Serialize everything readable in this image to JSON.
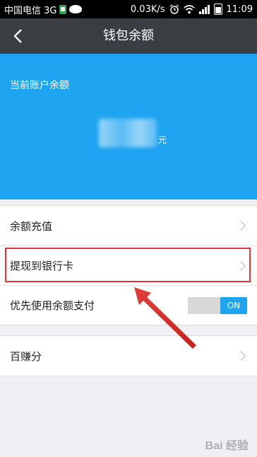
{
  "status_bar": {
    "carrier": "中国电信 3G",
    "speed": "0.03K/s",
    "time": "11:09"
  },
  "nav": {
    "title": "钱包余额"
  },
  "balance": {
    "label": "当前账户余额",
    "unit": "元"
  },
  "menu": {
    "recharge": "余额充值",
    "withdraw": "提现到银行卡",
    "prefer_balance": "优先使用余额支付",
    "toggle_label": "ON",
    "points": "百赚分"
  },
  "watermark": "Bai 经验",
  "colors": {
    "accent": "#1ea4f0",
    "nav_bg": "#3a3d42",
    "highlight": "#d9363e"
  }
}
